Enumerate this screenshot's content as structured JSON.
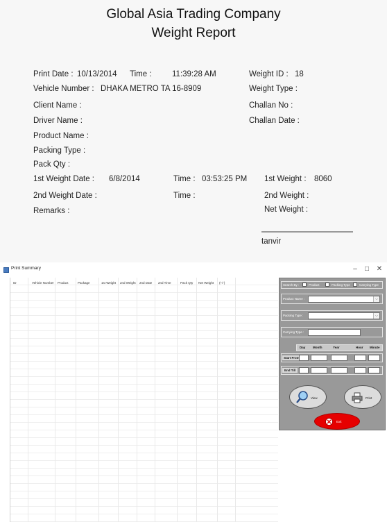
{
  "report": {
    "company": "Global Asia Trading Company",
    "title": "Weight Report",
    "print_date_label": "Print Date :",
    "print_date": "10/13/2014",
    "time_label": "Time :",
    "time": "11:39:28 AM",
    "weight_id_label": "Weight ID :",
    "weight_id": "18",
    "vehicle_label": "Vehicle Number :",
    "vehicle": "DHAKA METRO TA 16-8909",
    "weight_type_label": "Weight Type :",
    "client_label": "Client Name :",
    "challan_no_label": "Challan No :",
    "driver_label": "Driver Name :",
    "challan_date_label": "Challan Date :",
    "product_label": "Product Name :",
    "packing_label": "Packing Type :",
    "pack_qty_label": "Pack Qty :",
    "first_date_label": "1st Weight Date :",
    "first_date": "6/8/2014",
    "first_time_label": "Time :",
    "first_time": "03:53:25 PM",
    "first_weight_label": "1st Weight :",
    "first_weight": "8060",
    "second_date_label": "2nd Weight Date :",
    "second_time_label": "Time :",
    "second_weight_label": "2nd Weight :",
    "remarks_label": "Remarks :",
    "net_weight_label": "Net Weight :",
    "signature": "tanvir"
  },
  "window": {
    "title": "Print Summary",
    "minimize": "–",
    "maximize": "□",
    "close": "✕"
  },
  "grid": {
    "columns": [
      "ID",
      "Vehicle Number",
      "Product",
      "Package",
      "1st Weight",
      "2nd Weight",
      "2nd Date",
      "2nd Time",
      "Pack Qty",
      "Net Weight",
      "(+/-)"
    ]
  },
  "panel": {
    "search_by": "Search By :",
    "product_option": "Product",
    "packing_option": "Packing Type",
    "carrying_option": "Carrying Type",
    "product_name": "Product Name :",
    "packing_type": "Packing Type :",
    "carrying_type": "Carrying Type :",
    "day": "Day",
    "month": "Month",
    "year": "Year",
    "hour": "Hour",
    "minute": "Minute",
    "start_from": "Start From",
    "end_till": "End Till",
    "view_button": "View",
    "print_button": "Print",
    "exit_button": "Exit",
    "accent_red": "#e60000"
  }
}
